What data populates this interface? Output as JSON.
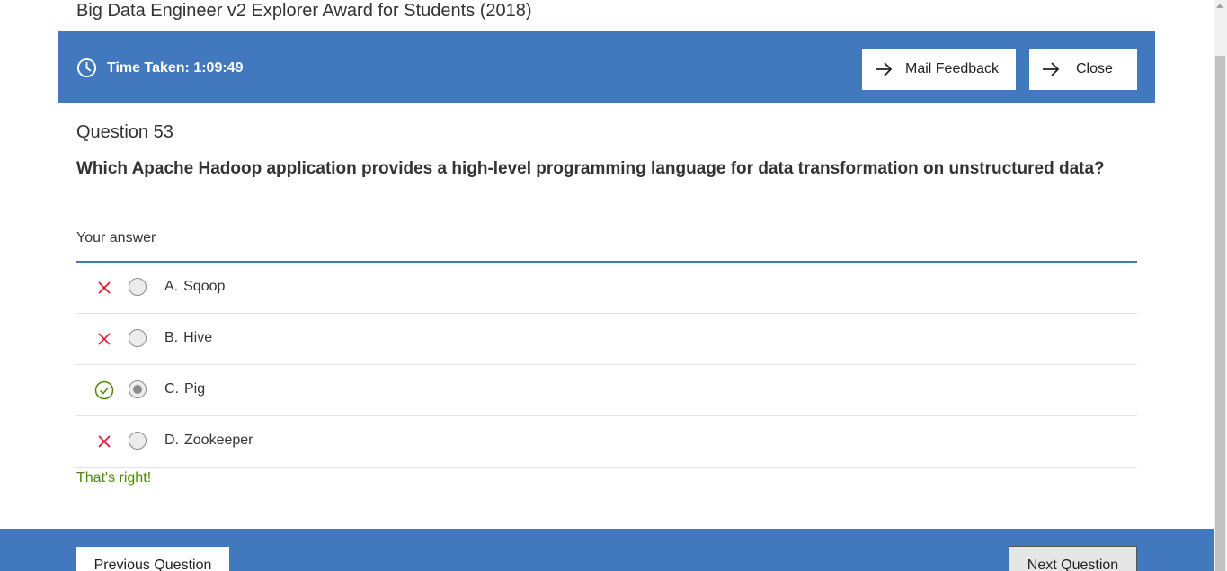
{
  "page": {
    "title": "Big Data Engineer v2 Explorer Award for Students (2018)"
  },
  "topbar": {
    "timer_label": "Time Taken: 1:09:49",
    "mail_feedback_label": "Mail Feedback",
    "close_label": "Close"
  },
  "question": {
    "number": "Question 53",
    "text": "Which Apache Hadoop application provides a high-level programming language for data transformation on unstructured data?",
    "your_answer_label": "Your answer",
    "options": [
      {
        "letter": "A.",
        "text": "Sqoop",
        "status": "incorrect",
        "selected": false
      },
      {
        "letter": "B.",
        "text": "Hive",
        "status": "incorrect",
        "selected": false
      },
      {
        "letter": "C.",
        "text": "Pig",
        "status": "correct",
        "selected": true
      },
      {
        "letter": "D.",
        "text": "Zookeeper",
        "status": "incorrect",
        "selected": false
      }
    ],
    "feedback": "That's right!"
  },
  "footer": {
    "previous_label": "Previous Question",
    "next_label": "Next Question"
  },
  "colors": {
    "brand_blue": "#4178be",
    "correct_green": "#4b8a00",
    "incorrect_red": "#e0182d"
  },
  "icons": {
    "timer": "clock-icon",
    "button_arrow": "arrow-right-icon",
    "incorrect": "x-icon",
    "correct": "check-circle-icon"
  }
}
